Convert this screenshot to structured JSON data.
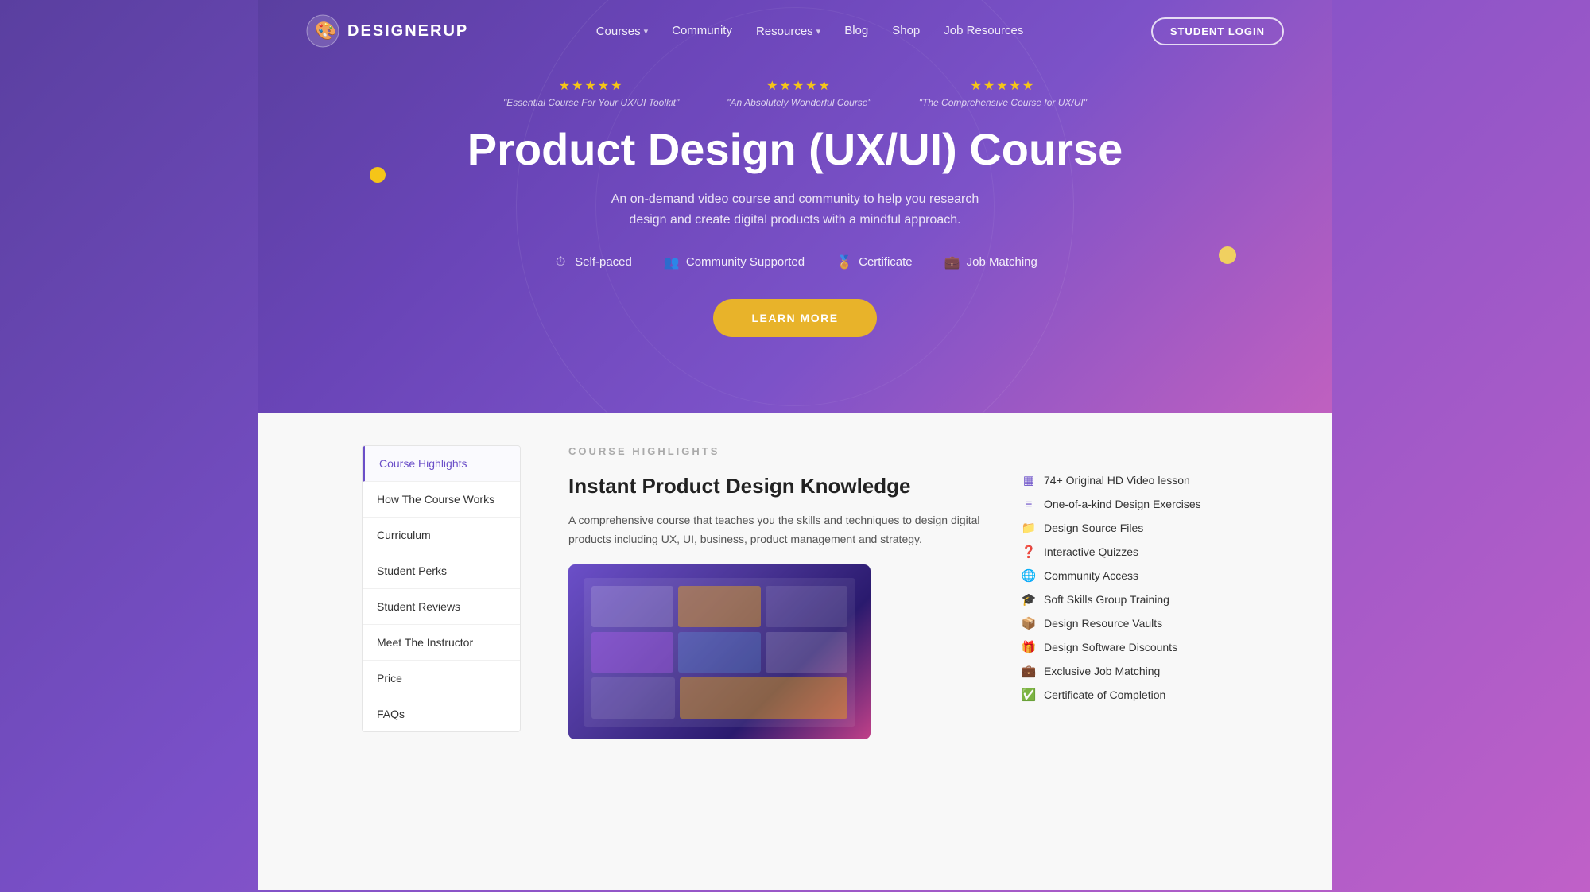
{
  "meta": {
    "title": "DesignerUp - Product Design (UX/UI) Course"
  },
  "navbar": {
    "logo_text": "DESIGNERUP",
    "nav_items": [
      {
        "label": "Courses",
        "has_dropdown": true
      },
      {
        "label": "Community",
        "has_dropdown": false
      },
      {
        "label": "Resources",
        "has_dropdown": true
      },
      {
        "label": "Blog",
        "has_dropdown": false
      },
      {
        "label": "Shop",
        "has_dropdown": false
      },
      {
        "label": "Job Resources",
        "has_dropdown": false
      }
    ],
    "login_button": "STUDENT LOGIN"
  },
  "hero": {
    "reviews": [
      {
        "stars": "★★★★★",
        "text": "\"Essential Course For Your UX/UI Toolkit\""
      },
      {
        "stars": "★★★★★",
        "text": "\"An Absolutely Wonderful Course\""
      },
      {
        "stars": "★★★★★",
        "text": "\"The Comprehensive Course for UX/UI\""
      }
    ],
    "title": "Product Design (UX/UI) Course",
    "subtitle": "An on-demand video course and community to help you research design and create digital products with a mindful approach.",
    "features": [
      {
        "icon": "⏱",
        "label": "Self-paced"
      },
      {
        "icon": "👥",
        "label": "Community Supported"
      },
      {
        "icon": "🏅",
        "label": "Certificate"
      },
      {
        "icon": "💼",
        "label": "Job Matching"
      }
    ],
    "cta_button": "LEARN MORE"
  },
  "sidebar": {
    "items": [
      {
        "label": "Course Highlights",
        "active": true
      },
      {
        "label": "How The Course Works",
        "active": false
      },
      {
        "label": "Curriculum",
        "active": false
      },
      {
        "label": "Student Perks",
        "active": false
      },
      {
        "label": "Student Reviews",
        "active": false
      },
      {
        "label": "Meet The Instructor",
        "active": false
      },
      {
        "label": "Price",
        "active": false
      },
      {
        "label": "FAQs",
        "active": false
      }
    ]
  },
  "course_highlights": {
    "section_label": "COURSE HIGHLIGHTS",
    "title": "Instant Product Design Knowledge",
    "description": "A comprehensive course that teaches you the skills and techniques to design digital products including UX, UI, business, product management and strategy.",
    "features_list": [
      {
        "icon": "▦",
        "label": "74+ Original HD Video lesson"
      },
      {
        "icon": "≡",
        "label": "One-of-a-kind Design Exercises"
      },
      {
        "icon": "📁",
        "label": "Design Source Files"
      },
      {
        "icon": "❓",
        "label": "Interactive Quizzes"
      },
      {
        "icon": "🌐",
        "label": "Community Access"
      },
      {
        "icon": "🎓",
        "label": "Soft Skills Group Training"
      },
      {
        "icon": "📦",
        "label": "Design Resource Vaults"
      },
      {
        "icon": "🎁",
        "label": "Design Software Discounts"
      },
      {
        "icon": "💼",
        "label": "Exclusive Job Matching"
      },
      {
        "icon": "✅",
        "label": "Certificate of Completion"
      }
    ]
  }
}
